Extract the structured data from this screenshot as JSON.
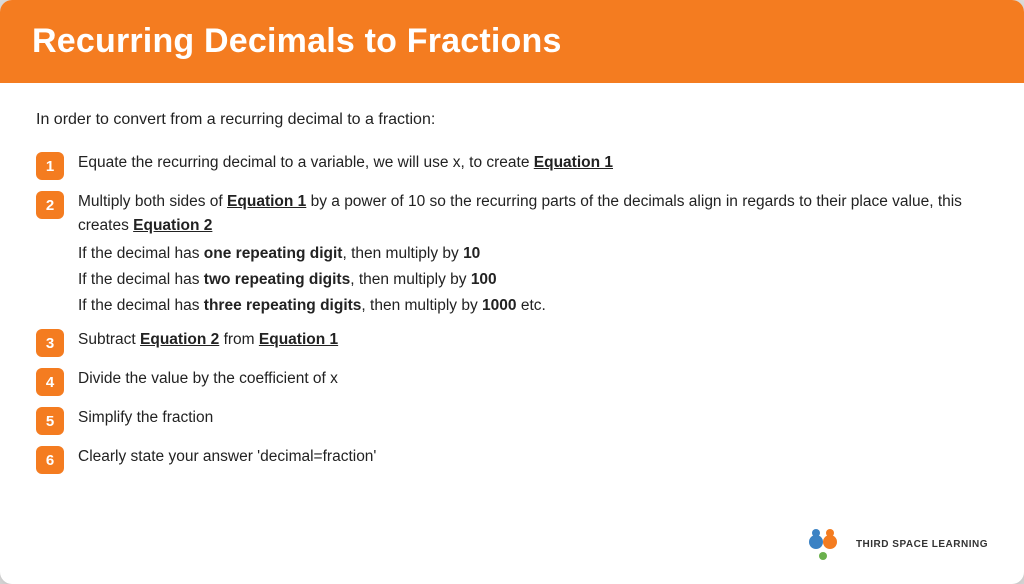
{
  "header": {
    "title": "Recurring Decimals to Fractions"
  },
  "intro": "In order to convert from a recurring decimal to a fraction:",
  "steps": [
    {
      "number": "1",
      "text": "Equate the recurring decimal to a variable, we will use x, to create ",
      "highlight": "Equation 1",
      "after": "",
      "extra_lines": []
    },
    {
      "number": "2",
      "text": "Multiply both sides of ",
      "highlight": "Equation 1",
      "after": " by a power of 10 so the recurring parts of the decimals align in regards to their place value, this creates ",
      "highlight2": "Equation 2",
      "extra_lines": [
        "If the decimal has <b>one repeating digit</b>, then multiply by <b>10</b>",
        "If the decimal has <b>two repeating digits</b>, then multiply by <b>100</b>",
        "If the decimal has <b>three repeating digits</b>, then multiply by <b>1000</b> etc."
      ]
    },
    {
      "number": "3",
      "text": "Subtract ",
      "highlight": "Equation 2",
      "after": " from ",
      "highlight3": "Equation 1",
      "extra_lines": []
    },
    {
      "number": "4",
      "text": "Divide the value by the coefficient of x",
      "extra_lines": []
    },
    {
      "number": "5",
      "text": "Simplify the fraction",
      "extra_lines": []
    },
    {
      "number": "6",
      "text": "Clearly state your answer ‘decimal=fraction’",
      "extra_lines": []
    }
  ],
  "logo": {
    "brand": "THIRD SPACE\nLEARNING"
  },
  "colors": {
    "orange": "#f47c20",
    "white": "#ffffff",
    "dark": "#222222"
  }
}
